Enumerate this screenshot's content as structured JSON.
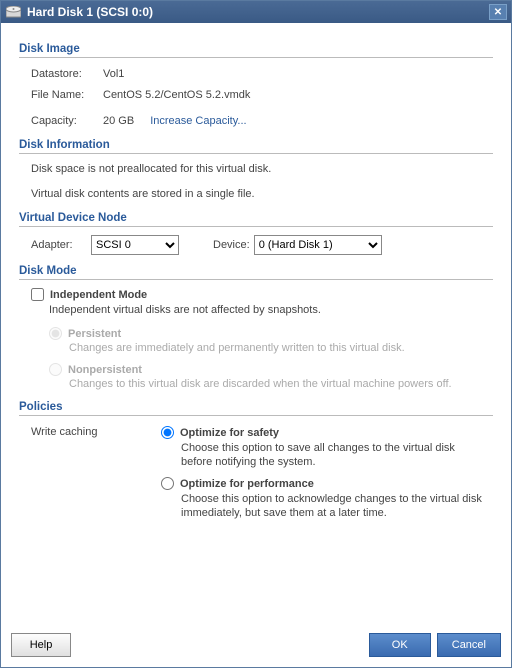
{
  "titlebar": {
    "title": "Hard Disk 1 (SCSI 0:0)"
  },
  "disk_image": {
    "heading": "Disk Image",
    "datastore_label": "Datastore:",
    "datastore_value": "Vol1",
    "filename_label": "File Name:",
    "filename_value": "CentOS 5.2/CentOS 5.2.vmdk",
    "capacity_label": "Capacity:",
    "capacity_value": "20 GB",
    "increase_link": "Increase Capacity..."
  },
  "disk_info": {
    "heading": "Disk Information",
    "line1": "Disk space is not preallocated for this virtual disk.",
    "line2": "Virtual disk contents are stored in a single file."
  },
  "device_node": {
    "heading": "Virtual Device Node",
    "adapter_label": "Adapter:",
    "adapter_value": "SCSI 0",
    "device_label": "Device:",
    "device_value": "0 (Hard Disk 1)"
  },
  "disk_mode": {
    "heading": "Disk Mode",
    "independent_label": "Independent Mode",
    "independent_desc": "Independent virtual disks are not affected by snapshots.",
    "persistent_label": "Persistent",
    "persistent_desc": "Changes are immediately and permanently written to this virtual disk.",
    "nonpersistent_label": "Nonpersistent",
    "nonpersistent_desc": "Changes to this virtual disk are discarded when the virtual machine powers off."
  },
  "policies": {
    "heading": "Policies",
    "write_caching_label": "Write caching",
    "safety_label": "Optimize for safety",
    "safety_desc": "Choose this option to save all changes to the virtual disk before notifying the system.",
    "perf_label": "Optimize for performance",
    "perf_desc": "Choose this option to acknowledge changes to the virtual disk immediately, but save them at a later time."
  },
  "buttons": {
    "help": "Help",
    "ok": "OK",
    "cancel": "Cancel"
  }
}
